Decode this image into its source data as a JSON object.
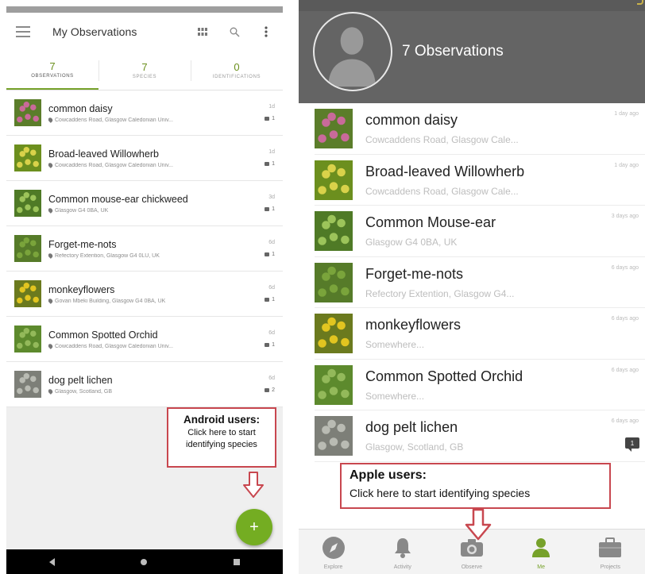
{
  "android": {
    "app_bar": {
      "title": "My Observations",
      "menu_icon": "menu-icon",
      "actions": [
        "grid-view-icon",
        "search-icon",
        "more-vert-icon"
      ]
    },
    "tabs": [
      {
        "count": "7",
        "label": "OBSERVATIONS",
        "active": true
      },
      {
        "count": "7",
        "label": "SPECIES",
        "active": false
      },
      {
        "count": "0",
        "label": "IDENTIFICATIONS",
        "active": false
      }
    ],
    "observations": [
      {
        "name": "common daisy",
        "location": "Cowcaddens Road, Glasgow Caledonian Univ...",
        "when": "1d",
        "comments": "1"
      },
      {
        "name": "Broad-leaved Willowherb",
        "location": "Cowcaddens Road, Glasgow Caledonian Univ...",
        "when": "1d",
        "comments": "1"
      },
      {
        "name": "Common mouse-ear chickweed",
        "location": "Glasgow G4 0BA, UK",
        "when": "3d",
        "comments": "1"
      },
      {
        "name": "Forget-me-nots",
        "location": "Refectory Extention, Glasgow G4 0LU, UK",
        "when": "6d",
        "comments": "1"
      },
      {
        "name": "monkeyflowers",
        "location": "Govan Mbeki Building, Glasgow G4 0BA, UK",
        "when": "6d",
        "comments": "1"
      },
      {
        "name": "Common Spotted Orchid",
        "location": "Cowcaddens Road, Glasgow Caledonian Univ...",
        "when": "6d",
        "comments": "1"
      },
      {
        "name": "dog pelt lichen",
        "location": "Glasgow, Scotland, GB",
        "when": "6d",
        "comments": "2"
      }
    ],
    "fab_label": "+",
    "callout": {
      "heading": "Android users:",
      "text": "Click here to start identifying species"
    },
    "colors": {
      "accent": "#74ad22",
      "callout_border": "#c8474f"
    }
  },
  "ios": {
    "header": {
      "count_text": "7 Observations",
      "avatar_icon": "person-avatar-icon"
    },
    "observations": [
      {
        "name": "common daisy",
        "location": "Cowcaddens Road, Glasgow Cale...",
        "when": "1 day ago"
      },
      {
        "name": "Broad-leaved Willowherb",
        "location": "Cowcaddens Road, Glasgow Cale...",
        "when": "1 day ago"
      },
      {
        "name": "Common Mouse-ear",
        "location": "Glasgow G4 0BA, UK",
        "when": "3 days ago"
      },
      {
        "name": "Forget-me-nots",
        "location": "Refectory Extention, Glasgow G4...",
        "when": "6 days ago"
      },
      {
        "name": "monkeyflowers",
        "location": "Somewhere...",
        "when": "6 days ago"
      },
      {
        "name": "Common Spotted Orchid",
        "location": "Somewhere...",
        "when": "6 days ago"
      },
      {
        "name": "dog pelt lichen",
        "location": "Glasgow, Scotland, GB",
        "when": "6 days ago",
        "badge": "1"
      }
    ],
    "tabbar": [
      {
        "label": "Explore",
        "icon": "compass-icon",
        "active": false
      },
      {
        "label": "Activity",
        "icon": "bell-icon",
        "active": false
      },
      {
        "label": "Observe",
        "icon": "camera-icon",
        "active": false
      },
      {
        "label": "Me",
        "icon": "person-icon",
        "active": true
      },
      {
        "label": "Projects",
        "icon": "briefcase-icon",
        "active": false
      }
    ],
    "callout": {
      "heading": "Apple users:",
      "text": "Click here to start identifying species"
    }
  }
}
